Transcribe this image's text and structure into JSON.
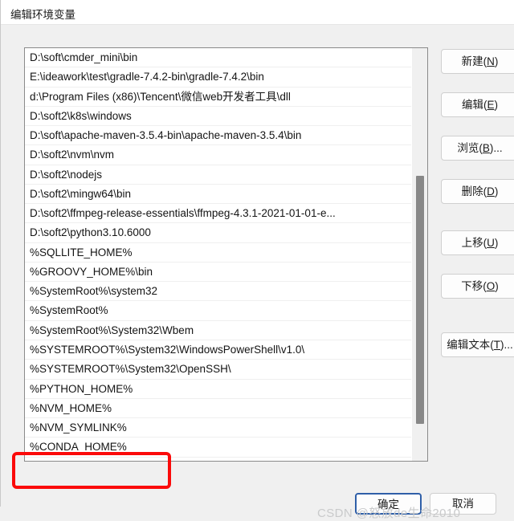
{
  "window": {
    "title": "编辑环境变量"
  },
  "list": {
    "items": [
      "D:\\soft\\cmder_mini\\bin",
      "E:\\ideawork\\test\\gradle-7.4.2-bin\\gradle-7.4.2\\bin",
      "d:\\Program Files (x86)\\Tencent\\微信web开发者工具\\dll",
      "D:\\soft2\\k8s\\windows",
      "D:\\soft\\apache-maven-3.5.4-bin\\apache-maven-3.5.4\\bin",
      "D:\\soft2\\nvm\\nvm",
      "D:\\soft2\\nodejs",
      "D:\\soft2\\mingw64\\bin",
      "D:\\soft2\\ffmpeg-release-essentials\\ffmpeg-4.3.1-2021-01-01-e...",
      "D:\\soft2\\python3.10.6000",
      "%SQLLITE_HOME%",
      "%GROOVY_HOME%\\bin",
      "%SystemRoot%\\system32",
      "%SystemRoot%",
      "%SystemRoot%\\System32\\Wbem",
      "%SYSTEMROOT%\\System32\\WindowsPowerShell\\v1.0\\",
      "%SYSTEMROOT%\\System32\\OpenSSH\\",
      "%PYTHON_HOME%",
      "%NVM_HOME%",
      "%NVM_SYMLINK%",
      "%CONDA_HOME%",
      ""
    ],
    "highlighted_item": "%CONDA_HOME%",
    "highlight_color": "#fb0a0a",
    "scrollbar": {
      "thumb_color": "#888888"
    }
  },
  "side_buttons": [
    {
      "id": "new",
      "label_prefix": "新建(",
      "accel": "N",
      "label_suffix": ")"
    },
    {
      "id": "edit",
      "label_prefix": "编辑(",
      "accel": "E",
      "label_suffix": ")"
    },
    {
      "id": "browse",
      "label_prefix": "浏览(",
      "accel": "B",
      "label_suffix": ")..."
    },
    {
      "id": "delete",
      "label_prefix": "删除(",
      "accel": "D",
      "label_suffix": ")"
    },
    {
      "id": "move_up",
      "label_prefix": "上移(",
      "accel": "U",
      "label_suffix": ")"
    },
    {
      "id": "move_down",
      "label_prefix": "下移(",
      "accel": "O",
      "label_suffix": ")"
    },
    {
      "id": "edit_text",
      "label_prefix": "编辑文本(",
      "accel": "T",
      "label_suffix": ")..."
    }
  ],
  "bottom_buttons": {
    "ok": "确定",
    "cancel": "取消",
    "ok_focus_color": "#2f5fa8"
  },
  "watermark": {
    "text": "CSDN @怒放de生命2010"
  }
}
